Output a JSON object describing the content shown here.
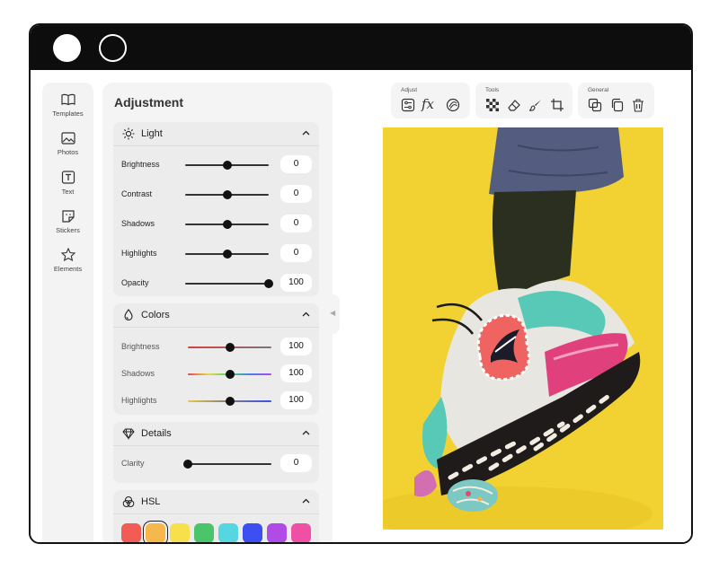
{
  "sidebar": {
    "items": [
      {
        "label": "Templates",
        "icon": "book-open-icon"
      },
      {
        "label": "Photos",
        "icon": "image-icon"
      },
      {
        "label": "Text",
        "icon": "text-icon"
      },
      {
        "label": "Stickers",
        "icon": "sticker-icon"
      },
      {
        "label": "Elements",
        "icon": "star-icon"
      }
    ]
  },
  "panel": {
    "title": "Adjustment",
    "light": {
      "title": "Light",
      "rows": [
        {
          "label": "Brightness",
          "value": "0",
          "level": 0.5
        },
        {
          "label": "Contrast",
          "value": "0",
          "level": 0.5
        },
        {
          "label": "Shadows",
          "value": "0",
          "level": 0.5
        },
        {
          "label": "Highlights",
          "value": "0",
          "level": 0.5
        },
        {
          "label": "Opacity",
          "value": "100",
          "level": 1.0
        }
      ]
    },
    "colors": {
      "title": "Colors",
      "rows": [
        {
          "label": "Brightness",
          "value": "100",
          "level": 0.5
        },
        {
          "label": "Shadows",
          "value": "100",
          "level": 0.5
        },
        {
          "label": "Highlights",
          "value": "100",
          "level": 0.5
        }
      ]
    },
    "details": {
      "title": "Details",
      "rows": [
        {
          "label": "Clarity",
          "value": "0",
          "level": 0.0
        }
      ]
    },
    "hsl": {
      "title": "HSL",
      "swatches": [
        "#f25c54",
        "#f7b84b",
        "#f7e04b",
        "#4cc46a",
        "#56d6e0",
        "#3d4ef2",
        "#b04be8",
        "#f04fa6"
      ],
      "selected_swatch": 1
    }
  },
  "toolbar": {
    "adjust": {
      "label": "Adjust",
      "tools": [
        "adjust-sliders-icon",
        "fx-icon",
        "filter-icon"
      ]
    },
    "tools": {
      "label": "Tools",
      "tools": [
        "transparency-icon",
        "eraser-icon",
        "brush-icon",
        "crop-icon"
      ]
    },
    "general": {
      "label": "General",
      "tools": [
        "layers-icon",
        "duplicate-icon",
        "trash-icon"
      ]
    },
    "fx_text": "fx"
  },
  "colors": {
    "accent": "#111111",
    "photo_background": "#f1d232"
  }
}
